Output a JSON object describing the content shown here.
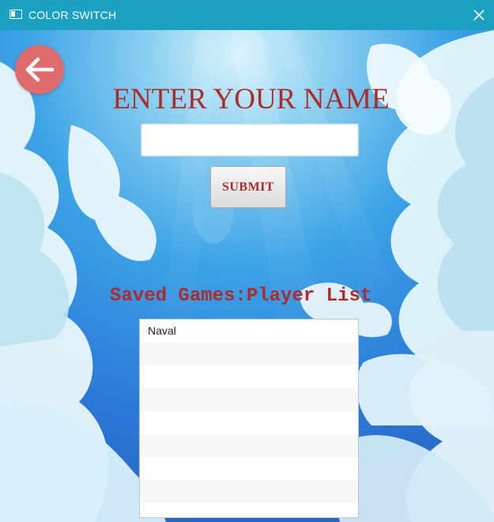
{
  "window": {
    "title": "COLOR SWITCH",
    "title_bar_color": "#1ba0c2"
  },
  "icons": {
    "app": "window-app-icon",
    "close": "close-icon",
    "back": "arrow-left-icon"
  },
  "form": {
    "heading": "ENTER YOUR NAME",
    "name_value": "",
    "submit_label": "SUBMIT"
  },
  "saved_games": {
    "heading": "Saved Games:Player List",
    "players": [
      "Naval",
      "",
      "",
      "",
      "",
      "",
      "",
      "",
      ""
    ]
  },
  "colors": {
    "accent_red": "#b02a2a",
    "back_button": "#e06b6f",
    "sky": "#2a8fd8"
  }
}
